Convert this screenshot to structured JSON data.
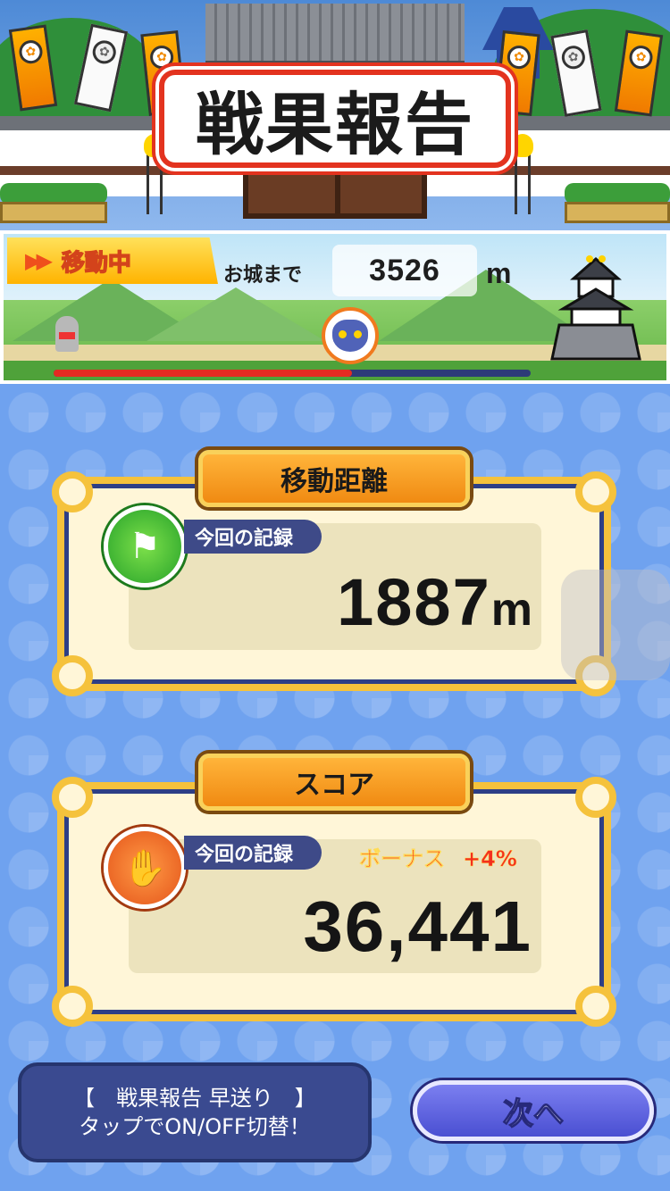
{
  "header": {
    "title": "戦果報告"
  },
  "progress": {
    "status_label": "移動中",
    "to_castle_label": "お城まで",
    "remaining_distance": "3526",
    "remaining_unit": "m",
    "progress_fraction": 0.626
  },
  "distance_card": {
    "title": "移動距離",
    "record_label": "今回の記録",
    "value": "1887",
    "unit": "m"
  },
  "score_card": {
    "title": "スコア",
    "record_label": "今回の記録",
    "bonus_label": "ボーナス",
    "bonus_value": "+4%",
    "value": "36,441"
  },
  "footer": {
    "fast_forward_line1": "【　戦果報告 早送り　】",
    "fast_forward_line2": "タップでON/OFF切替！",
    "next_label": "次へ"
  },
  "colors": {
    "accent_orange": "#f08a12",
    "frame_gold": "#f5c23c",
    "panel_navy": "#2d3f86",
    "progress_red": "#e52a22",
    "bonus_red": "#f32f1e"
  },
  "icons": [
    "paw-banner-icon",
    "signpost-icon",
    "cat-paw-fan-icon",
    "cat-face-icon",
    "castle-icon"
  ]
}
